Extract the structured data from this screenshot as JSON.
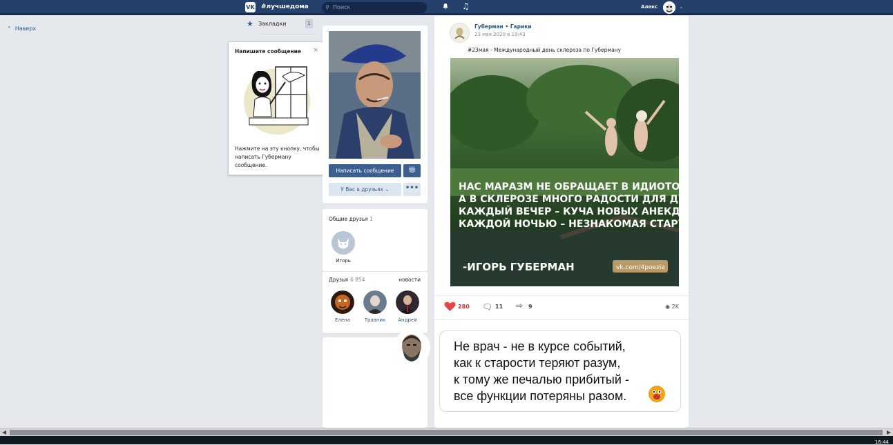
{
  "topbar": {
    "logo": "VK",
    "brand": "#лучшедома",
    "search_placeholder": "Поиск",
    "user_name": "Алекс"
  },
  "left": {
    "back_to_top": "Наверх",
    "bookmarks_label": "Закладки",
    "bookmarks_count": "1"
  },
  "tooltip": {
    "title": "Напишите сообщение",
    "close": "×",
    "lines": [
      "Нажмите на эту кнопку, чтобы",
      "написать Губерману",
      "сообщение."
    ]
  },
  "profile": {
    "message_button": "Написать сообщение",
    "friends_button": "У Вас в друзьях ⌄",
    "more_button": "•••"
  },
  "mutual": {
    "title": "Общие друзья",
    "count": "1",
    "friend_name": "Игорь"
  },
  "friends": {
    "title": "Друзья",
    "count": "6 854",
    "news_link": "новости",
    "items": [
      {
        "name": "Елена"
      },
      {
        "name": "Травник"
      },
      {
        "name": "Андрей"
      }
    ]
  },
  "post": {
    "author": "Губерман • Гарики",
    "date": "23 мая 2020 в 19:43",
    "text": "#23мая - Международный день склероза по Губерману",
    "image_lines": [
      "НАС МАРАЗМ НЕ ОБРАЩАЕТ В ИДИОТОВ,",
      "А В СКЛЕРОЗЕ МНОГО РАДОСТИ ДЛЯ ДУХА:",
      "КАЖДЫЙ ВЕЧЕР – КУЧА НОВЫХ АНЕКДОТОВ,",
      "КАЖДОЙ НОЧЬЮ – НЕЗНАКОМАЯ СТАРУХА."
    ],
    "image_author": "-ИГОРЬ ГУБЕРМАН",
    "image_watermark": "vk.com/4poezia",
    "likes": "280",
    "comments": "11",
    "shares": "9",
    "views": "2K"
  },
  "comment": {
    "lines": [
      "Не врач - не в курсе событий,",
      "как к старости теряют разум,",
      "к тому же печалью прибитый -",
      "все функции потеряны разом."
    ]
  },
  "system": {
    "clock": "16:44"
  },
  "colors": {
    "header": "#25406a",
    "button": "#3c5f8f",
    "link": "#2a5885",
    "like": "#e64646"
  }
}
